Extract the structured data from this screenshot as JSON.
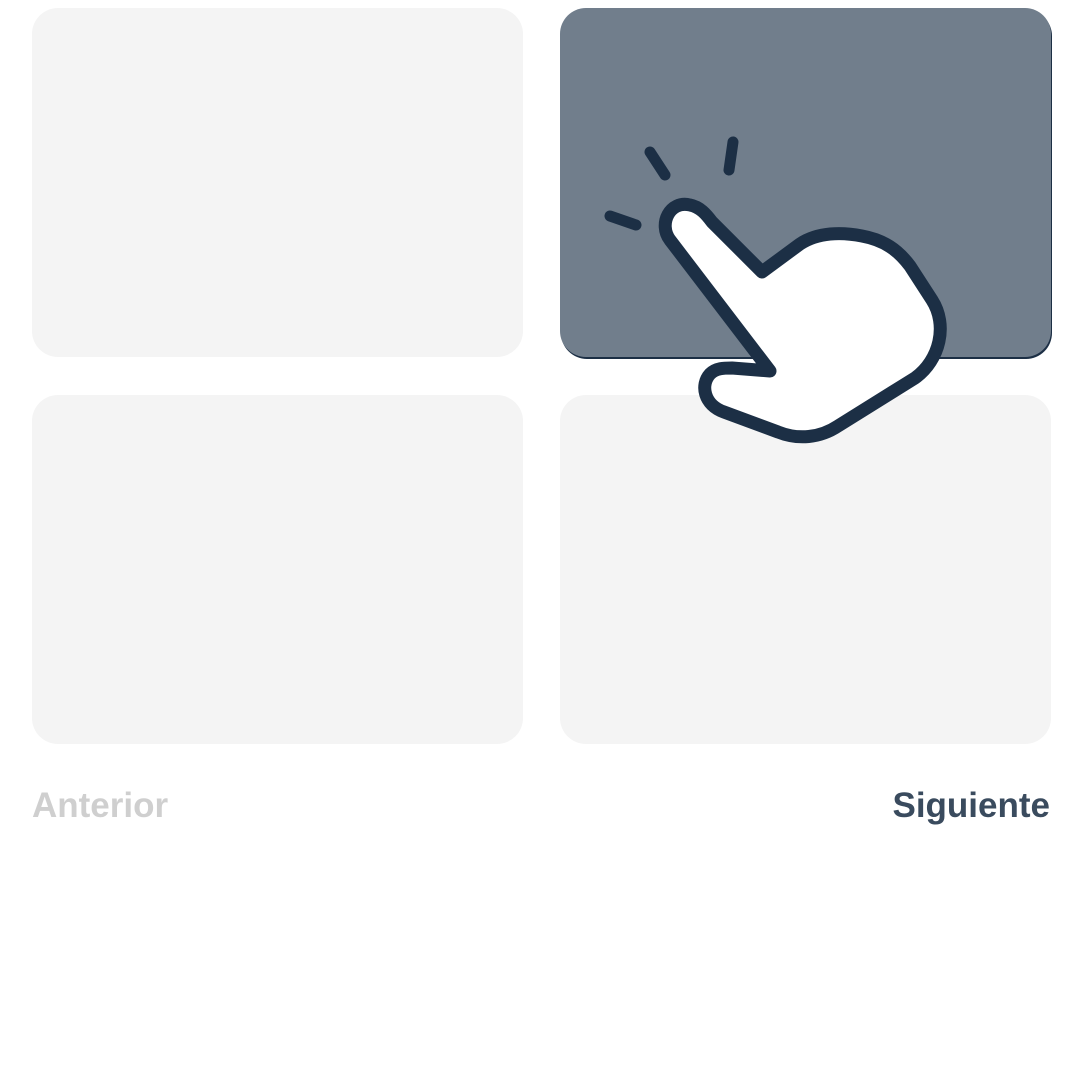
{
  "tiles": [
    {
      "id": "top-left",
      "selected": false
    },
    {
      "id": "top-right",
      "selected": true
    },
    {
      "id": "bottom-left",
      "selected": false
    },
    {
      "id": "bottom-right",
      "selected": false
    }
  ],
  "colors": {
    "tile_default": "#f4f4f4",
    "tile_selected": "#717e8c",
    "outline": "#1c2f45",
    "prev_disabled": "#cfcfcf",
    "next_active": "#3a4b5e"
  },
  "navigation": {
    "prev_label": "Anterior",
    "prev_enabled": false,
    "next_label": "Siguiente",
    "next_enabled": true
  },
  "overlay": {
    "icon": "tap-hand-icon"
  }
}
